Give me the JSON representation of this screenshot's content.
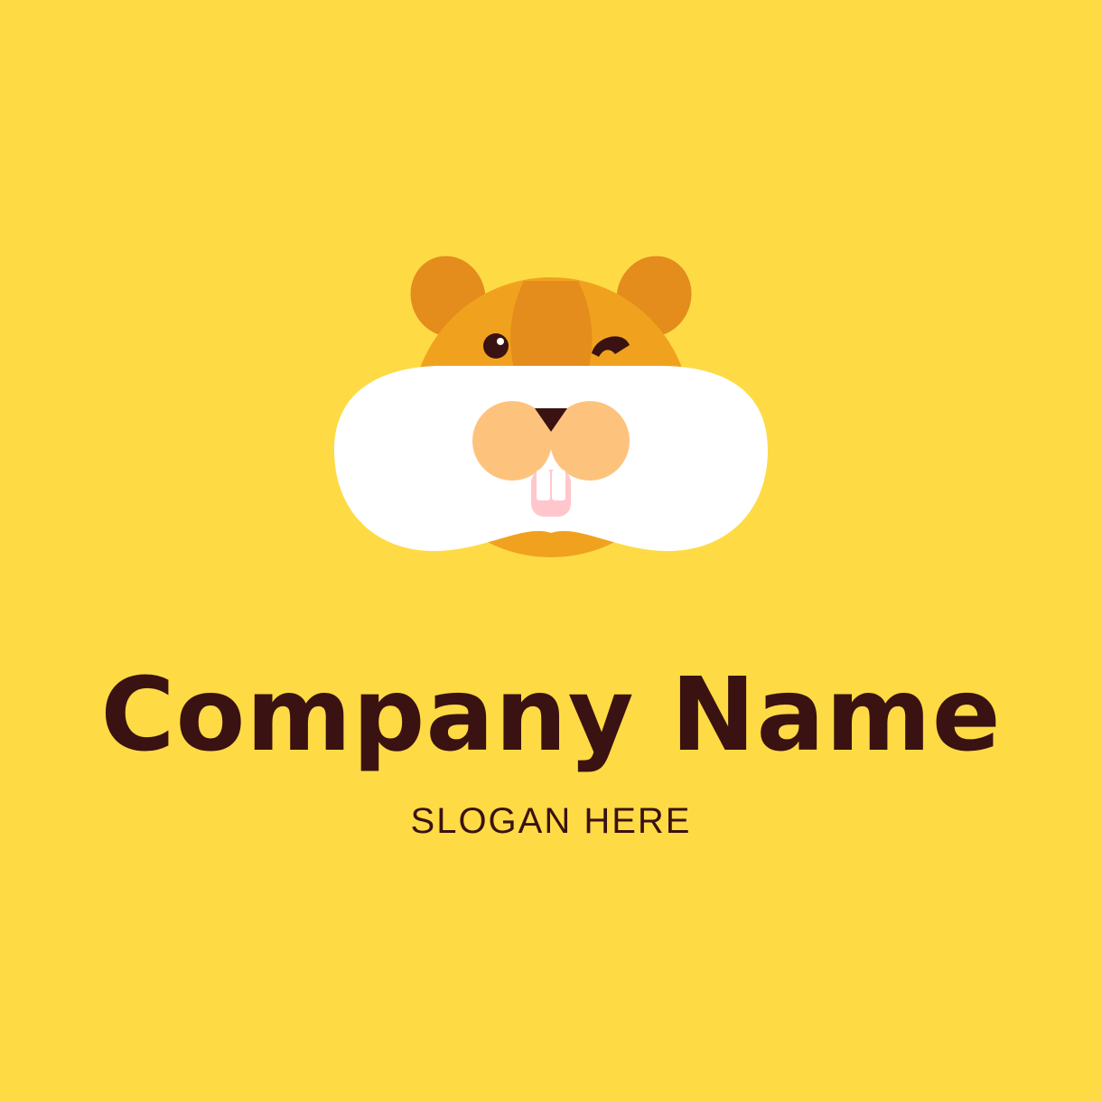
{
  "brand": {
    "company_name": "Company Name",
    "slogan": "SLOGAN HERE"
  },
  "colors": {
    "background": "#FEDB45",
    "text": "#3A1212",
    "fur_light": "#F0A21F",
    "fur_dark": "#E48C1C",
    "cheek": "#FFFFFF",
    "muzzle": "#FDC37D",
    "nose": "#3A1212",
    "teeth": "#FFFFFF",
    "mouth_pink": "#FFC7CC"
  },
  "icons": {
    "mascot": "hamster-face-winking-icon"
  }
}
